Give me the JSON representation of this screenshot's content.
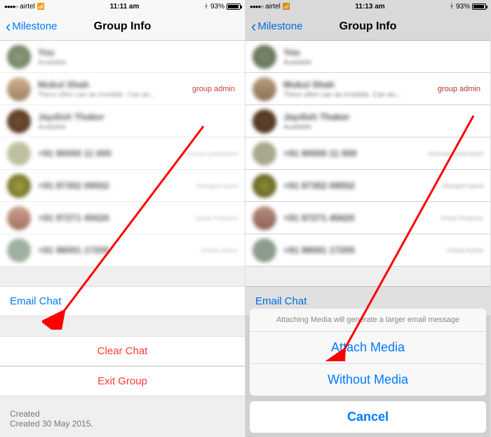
{
  "statusbar": {
    "carrier": "airtel",
    "time_left": "11:11 am",
    "time_right": "11:13 am",
    "battery": "93%"
  },
  "nav": {
    "back_label": "Milestone",
    "title": "Group Info"
  },
  "members": {
    "admin_tag": "group admin",
    "m0_name": "You",
    "m0_status": "Available",
    "m1_name": "Mukul Shah",
    "m1_status": "There often can as invisible. Can an...",
    "m2_name": "Jaydish Thaker",
    "m2_status": "Available",
    "m3_name": "+91 90000 11 000",
    "m4_name": "+91 87352 09552",
    "m5_name": "+91 97271 45620",
    "m6_name": "+91 98091 17205"
  },
  "actions": {
    "email_chat": "Email Chat",
    "clear_chat": "Clear Chat",
    "exit_group": "Exit Group"
  },
  "created": {
    "line1": "Created",
    "line2": "Created 30 May 2015."
  },
  "sheet": {
    "message": "Attaching Media will generate a larger email message",
    "attach": "Attach Media",
    "without": "Without Media",
    "cancel": "Cancel"
  }
}
